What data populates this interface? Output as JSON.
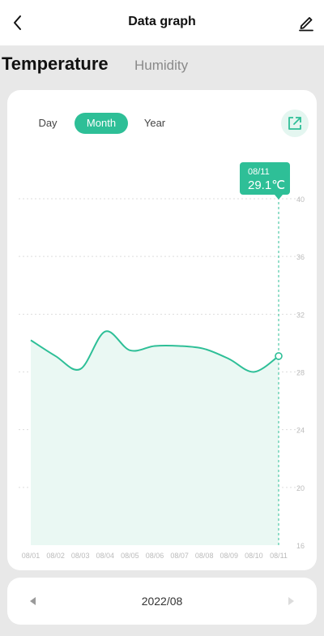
{
  "header": {
    "title": "Data graph",
    "back_icon": "chevron-left-icon",
    "edit_icon": "pencil-icon"
  },
  "metric_tabs": {
    "active": "Temperature",
    "inactive": "Humidity"
  },
  "range_tabs": {
    "day": "Day",
    "month": "Month",
    "year": "Year",
    "selected": "Month"
  },
  "export_icon": "share-export-icon",
  "tooltip": {
    "date": "08/11",
    "value": "29.1℃"
  },
  "colors": {
    "accent": "#2ebf97",
    "area_fill": "#eaf8f3",
    "grid": "#dddddd",
    "axis_text": "#bbbbbb"
  },
  "chart_data": {
    "type": "area",
    "x": [
      "08/01",
      "08/02",
      "08/03",
      "08/04",
      "08/05",
      "08/06",
      "08/07",
      "08/08",
      "08/09",
      "08/10",
      "08/11"
    ],
    "series": [
      {
        "values": [
          30.2,
          29.1,
          28.2,
          30.8,
          29.5,
          29.8,
          29.8,
          29.6,
          28.9,
          28.0,
          29.1
        ]
      }
    ],
    "ylim": [
      16,
      40
    ],
    "yticks": [
      16,
      20,
      24,
      28,
      32,
      36,
      40
    ],
    "selected_index": 10,
    "grid": true
  },
  "date_bar": {
    "label": "2022/08",
    "prev_icon": "triangle-left-icon",
    "next_icon": "triangle-right-icon"
  }
}
